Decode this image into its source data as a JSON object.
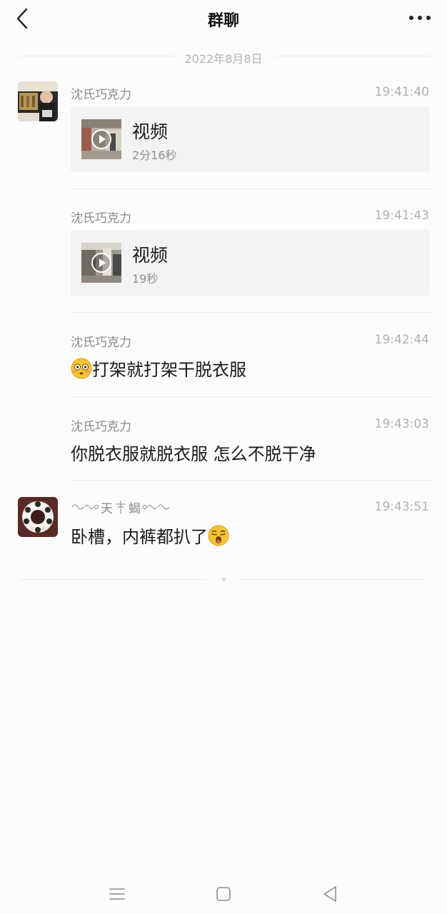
{
  "header": {
    "title": "群聊",
    "back_icon": "chevron-left-icon",
    "more_icon": "more-dots-icon"
  },
  "date_separator": "2022年8月8日",
  "messages": [
    {
      "sender": "沈氏巧克力",
      "time": "19:41:40",
      "type": "video",
      "video_title": "视频",
      "video_duration": "2分16秒"
    },
    {
      "sender": "沈氏巧克力",
      "time": "19:41:43",
      "type": "video",
      "video_title": "视频",
      "video_duration": "19秒"
    },
    {
      "sender": "沈氏巧克力",
      "time": "19:42:44",
      "type": "text",
      "emoji": "flushed-face-emoji",
      "text": "打架就打架干脱衣服"
    },
    {
      "sender": "沈氏巧克力",
      "time": "19:43:03",
      "type": "text",
      "text": "你脱衣服就脱衣服 怎么不脱干净"
    },
    {
      "sender_part1": "天",
      "sender_part2": "蝎",
      "time": "19:43:51",
      "type": "text",
      "text": "卧槽，内裤都扒了",
      "emoji": "astonished-face-emoji"
    }
  ],
  "navbar": {
    "menu_icon": "menu-icon",
    "home_icon": "home-square-icon",
    "back_icon": "back-triangle-icon"
  },
  "colors": {
    "background": "#fcfcfc",
    "card_background": "#f3f3f3",
    "title_text": "#111111",
    "secondary_text": "#8a8a8a",
    "time_text": "#b0b0b0",
    "divider": "#ebebeb"
  }
}
